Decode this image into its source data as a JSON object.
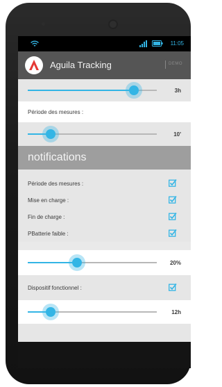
{
  "status_bar": {
    "time": "11:05"
  },
  "app_bar": {
    "title": "Aguila Tracking",
    "demo_label": "DEMO"
  },
  "settings": {
    "slider_1": {
      "value_label": "3h",
      "level": 0.82
    },
    "period_label_1": "Période des mesures :",
    "slider_2": {
      "value_label": "10'",
      "level": 0.18
    },
    "section_title": "notifications",
    "notif_items": [
      {
        "label": "Période des mesures :",
        "checked": true
      },
      {
        "label": "Mise en charge :",
        "checked": true
      },
      {
        "label": "Fin de charge :",
        "checked": true
      },
      {
        "label": "PBatterie faible :",
        "checked": true
      }
    ],
    "slider_3": {
      "value_label": "20%",
      "level": 0.38
    },
    "device_item": {
      "label": "Dispositif fonctionnel :",
      "checked": true
    },
    "slider_4": {
      "value_label": "12h",
      "level": 0.18
    }
  },
  "colors": {
    "accent": "#33b5e5",
    "app_bar": "#555555",
    "section_header": "#9e9e9e"
  }
}
